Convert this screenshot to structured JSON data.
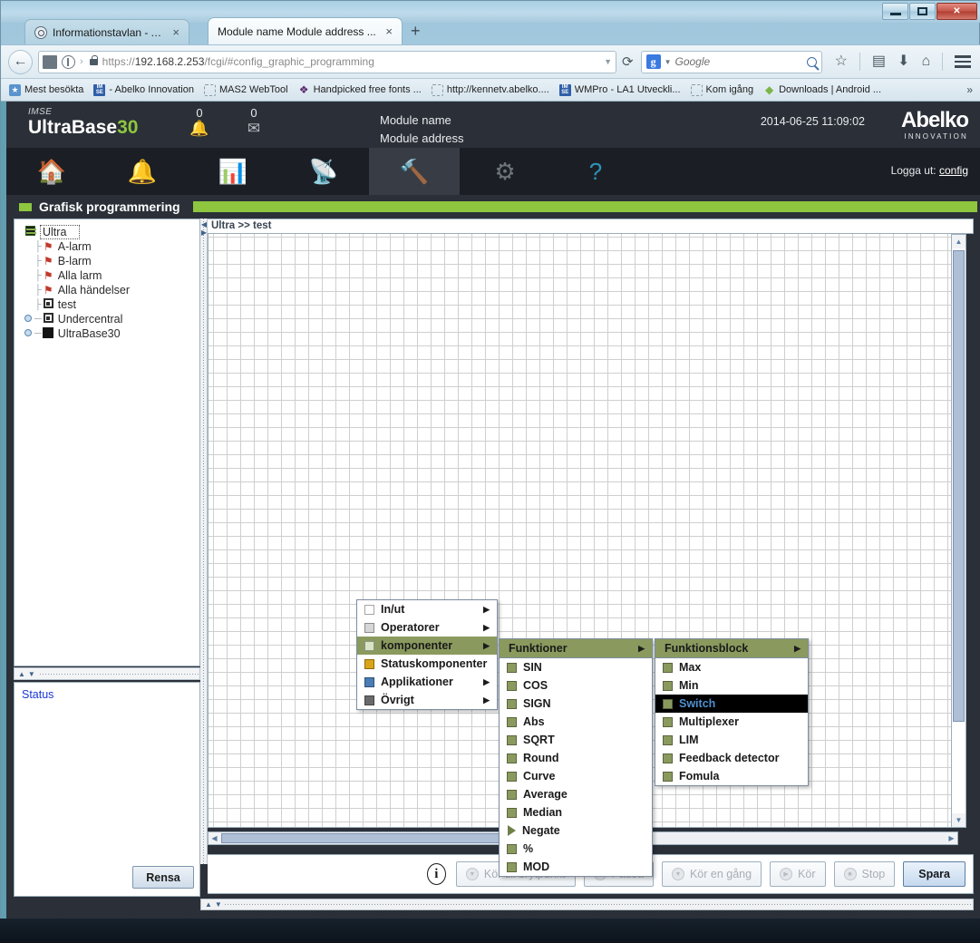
{
  "browser": {
    "tabs": [
      {
        "title": "Informationstavlan - Abelk...",
        "active": false,
        "close": "×"
      },
      {
        "title": "Module name Module address ...",
        "active": true,
        "close": "×"
      }
    ],
    "new_tab": "+",
    "url_scheme": "https://",
    "url_host": "192.168.2.253",
    "url_path": "/fcgi/#config_graphic_programming",
    "search_engine": "Google",
    "search_placeholder": "Google",
    "bookmarks": [
      {
        "label": "Mest besökta",
        "icon": "star-icon"
      },
      {
        "label": "- Abelko Innovation",
        "icon": "imse-icon"
      },
      {
        "label": "MAS2 WebTool",
        "icon": "blank-icon"
      },
      {
        "label": "Handpicked free fonts ...",
        "icon": "firefox-icon"
      },
      {
        "label": "http://kennetv.abelko....",
        "icon": "blank-icon"
      },
      {
        "label": "WMPro - LA1 Utveckli...",
        "icon": "imse-icon"
      },
      {
        "label": "Kom igång",
        "icon": "blank-icon"
      },
      {
        "label": "Downloads | Android ...",
        "icon": "android-icon"
      }
    ],
    "bookmarks_overflow": "»",
    "window_controls": {
      "minimize": "–",
      "maximize": "□",
      "close": "✕"
    }
  },
  "app": {
    "brand_top": "IMSE",
    "brand_name": "UltraBase",
    "brand_number": "30",
    "alarm_count": "0",
    "message_count": "0",
    "module_name": "Module name",
    "module_address": "Module address",
    "datetime": "2014-06-25 11:09:02",
    "logo_main": "Abelko",
    "logo_sub": "INNOVATION",
    "logout_label": "Logga ut:",
    "logout_user": "config",
    "nav": [
      {
        "name": "home-icon",
        "glyph": "⌂",
        "active": false
      },
      {
        "name": "bell-icon",
        "glyph": "🔔",
        "active": false
      },
      {
        "name": "chart-icon",
        "glyph": "📊",
        "active": false
      },
      {
        "name": "antenna-icon",
        "glyph": "Ȧ",
        "active": false
      },
      {
        "name": "tools-icon",
        "glyph": "✒",
        "active": true
      },
      {
        "name": "gears-icon",
        "glyph": "⚙",
        "active": false
      },
      {
        "name": "help-icon",
        "glyph": "?",
        "active": false
      }
    ],
    "section_title": "Grafisk programmering"
  },
  "tree": {
    "nodes": [
      {
        "label": "Ultra",
        "icon": "stack-icon",
        "depth": 0,
        "expander": "",
        "root": true
      },
      {
        "label": "A-larm",
        "icon": "alarm-icon",
        "depth": 1,
        "expander": ""
      },
      {
        "label": "B-larm",
        "icon": "alarm-icon",
        "depth": 1,
        "expander": ""
      },
      {
        "label": "Alla larm",
        "icon": "alarm-icon",
        "depth": 1,
        "expander": ""
      },
      {
        "label": "Alla händelser",
        "icon": "alarm-icon",
        "depth": 1,
        "expander": ""
      },
      {
        "label": "test",
        "icon": "box-icon",
        "depth": 1,
        "expander": ""
      },
      {
        "label": "Undercentral",
        "icon": "box-icon",
        "depth": 1,
        "expander": "knob"
      },
      {
        "label": "UltraBase30",
        "icon": "solid-icon",
        "depth": 1,
        "expander": "knob"
      }
    ]
  },
  "status_panel": {
    "label": "Status",
    "clear_button": "Rensa"
  },
  "canvas": {
    "breadcrumb": "Ultra >> test"
  },
  "toolbar": {
    "buttons": [
      {
        "label": "Kör till brytpunkt",
        "glyph": "▼",
        "disabled": true
      },
      {
        "label": "Pausa",
        "glyph": "‖",
        "disabled": true
      },
      {
        "label": "Kör en gång",
        "glyph": "▼",
        "disabled": true
      },
      {
        "label": "Kör",
        "glyph": "▶",
        "disabled": true
      },
      {
        "label": "Stop",
        "glyph": "■",
        "disabled": true
      }
    ],
    "save_label": "Spara",
    "info_glyph": "i"
  },
  "context_menu": {
    "level1": {
      "items": [
        {
          "label": "In/ut",
          "color": "#fefefe",
          "arrow": "▶",
          "highlighted": false
        },
        {
          "label": "Operatorer",
          "color": "#d6d6d6",
          "arrow": "▶",
          "highlighted": false
        },
        {
          "label": "komponenter",
          "color": "#d9e4c6",
          "arrow": "▶",
          "highlighted": true
        },
        {
          "label": "Statuskomponenter",
          "color": "#d9a41a",
          "arrow": "▶",
          "highlighted": false
        },
        {
          "label": "Applikationer",
          "color": "#4a7cb5",
          "arrow": "▶",
          "highlighted": false
        },
        {
          "label": "Övrigt",
          "color": "#6a6a6a",
          "arrow": "▶",
          "highlighted": false
        }
      ]
    },
    "level2": {
      "title": "Funktioner",
      "title_arrow": "▶",
      "items": [
        {
          "label": "SIN",
          "color": "#8a9a5e",
          "shape": "square"
        },
        {
          "label": "COS",
          "color": "#8a9a5e",
          "shape": "square"
        },
        {
          "label": "SIGN",
          "color": "#8a9a5e",
          "shape": "square"
        },
        {
          "label": "Abs",
          "color": "#8a9a5e",
          "shape": "square"
        },
        {
          "label": "SQRT",
          "color": "#8a9a5e",
          "shape": "square"
        },
        {
          "label": "Round",
          "color": "#8a9a5e",
          "shape": "square"
        },
        {
          "label": "Curve",
          "color": "#8a9a5e",
          "shape": "square"
        },
        {
          "label": "Average",
          "color": "#8a9a5e",
          "shape": "square"
        },
        {
          "label": "Median",
          "color": "#8a9a5e",
          "shape": "square"
        },
        {
          "label": "Negate",
          "color": "#6f7f4a",
          "shape": "triangle"
        },
        {
          "label": "%",
          "color": "#8a9a5e",
          "shape": "square"
        },
        {
          "label": "MOD",
          "color": "#8a9a5e",
          "shape": "square"
        }
      ]
    },
    "level3": {
      "title": "Funktionsblock",
      "title_arrow": "▶",
      "items": [
        {
          "label": "Max",
          "color": "#8a9a5e",
          "selected": false
        },
        {
          "label": "Min",
          "color": "#8a9a5e",
          "selected": false
        },
        {
          "label": "Switch",
          "color": "#8a9a5e",
          "selected": true
        },
        {
          "label": "Multiplexer",
          "color": "#8a9a5e",
          "selected": false
        },
        {
          "label": "LIM",
          "color": "#8a9a5e",
          "selected": false
        },
        {
          "label": "Feedback detector",
          "color": "#8a9a5e",
          "selected": false
        },
        {
          "label": "Fomula",
          "color": "#8a9a5e",
          "selected": false
        }
      ]
    }
  }
}
